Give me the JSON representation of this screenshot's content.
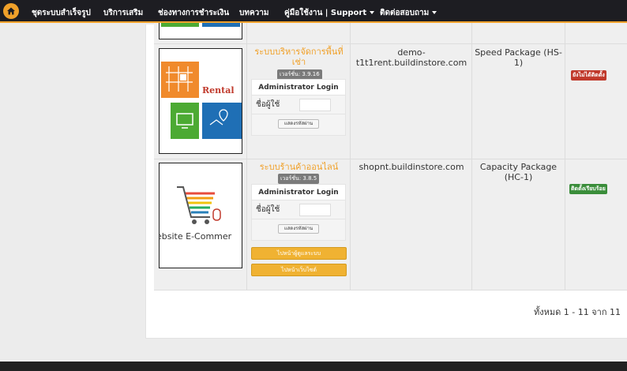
{
  "nav": {
    "items": [
      {
        "label": "ชุดระบบสำเร็จรูป"
      },
      {
        "label": "บริการเสริม"
      },
      {
        "label": "ช่องทางการชำระเงิน"
      },
      {
        "label": "บทความ"
      },
      {
        "label": "คู่มือใช้งาน | Support"
      },
      {
        "label": "ติดต่อสอบถาม"
      }
    ]
  },
  "rows": [
    {
      "thumb_text": "Rental",
      "name": "ระบบบริหารจัดการพื้นที่เช่า",
      "version": "เวอร์ชั่น: 3.9.16",
      "admin_title": "Administrator Login",
      "username_label": "ชื่อผู้ใช้",
      "show_password": "แสดงรหัสผ่าน",
      "domain": "demo-t1t1rent.buildinstore.com",
      "package": "Speed Package (HS-1)",
      "status": "ยังไม่ได้ติดตั้ง",
      "status_color": "#c0392b"
    },
    {
      "thumb_text": "ebsite E-Commer",
      "name": "ระบบร้านค้าออนไลน์",
      "version": "เวอร์ชั่น: 3.8.5",
      "admin_title": "Administrator Login",
      "username_label": "ชื่อผู้ใช้",
      "show_password": "แสดงรหัสผ่าน",
      "btn_backend": "ไปหน้าผู้ดูแลระบบ",
      "btn_website": "ไปหน้าเว็บไซต์",
      "domain": "shopnt.buildinstore.com",
      "package": "Capacity Package (HC-1)",
      "status": "ติดตั้งเรียบร้อย",
      "status_color": "#3a8d3a"
    }
  ],
  "pagination": {
    "summary": "ทั้งหมด 1 - 11 จาก 11"
  },
  "colors": {
    "accent": "#f0a12a",
    "nav_bg": "#1d1d22"
  }
}
